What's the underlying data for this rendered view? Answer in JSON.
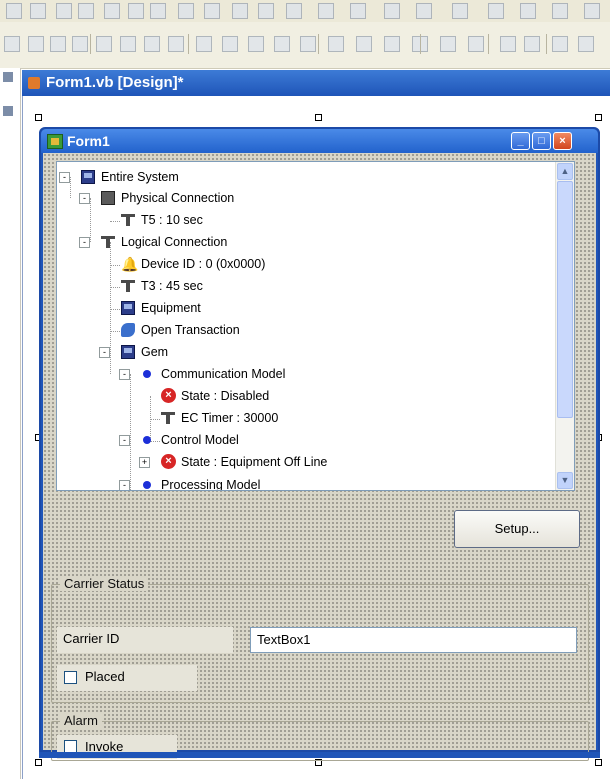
{
  "document": {
    "title": "Form1.vb [Design]*"
  },
  "form": {
    "title": "Form1",
    "caption_buttons": [
      "_",
      "□",
      "×"
    ]
  },
  "tree": {
    "nodes": [
      {
        "label": "Entire System",
        "icon": "system-icon",
        "expander": "-"
      },
      {
        "label": "Physical Connection",
        "icon": "network-card-icon",
        "expander": "-"
      },
      {
        "label": "T5 : 10 sec",
        "icon": "timer-icon"
      },
      {
        "label": "Logical Connection",
        "icon": "timer-icon",
        "expander": "-"
      },
      {
        "label": "Device ID : 0 (0x0000)",
        "icon": "bell-icon"
      },
      {
        "label": "T3 : 45 sec",
        "icon": "timer-icon"
      },
      {
        "label": "Equipment",
        "icon": "equipment-icon"
      },
      {
        "label": "Open Transaction",
        "icon": "transaction-icon"
      },
      {
        "label": "Gem",
        "icon": "system-icon",
        "expander": "-"
      },
      {
        "label": "Communication Model",
        "icon": "blue-dot-icon",
        "expander": "-"
      },
      {
        "label": "State : Disabled",
        "icon": "error-icon"
      },
      {
        "label": "EC Timer : 30000",
        "icon": "timer-icon"
      },
      {
        "label": "Control Model",
        "icon": "blue-dot-icon",
        "expander": "-"
      },
      {
        "label": "State : Equipment Off Line",
        "icon": "error-icon",
        "expander": "+"
      },
      {
        "label": "Processing Model",
        "icon": "blue-dot-icon",
        "expander": "-"
      }
    ]
  },
  "setup_button": {
    "label": "Setup..."
  },
  "carrier_status": {
    "title": "Carrier Status",
    "carrier_id_label": "Carrier ID",
    "carrier_id_value": "TextBox1",
    "placed_label": "Placed"
  },
  "alarm": {
    "title": "Alarm",
    "invoke_label": "Invoke"
  }
}
